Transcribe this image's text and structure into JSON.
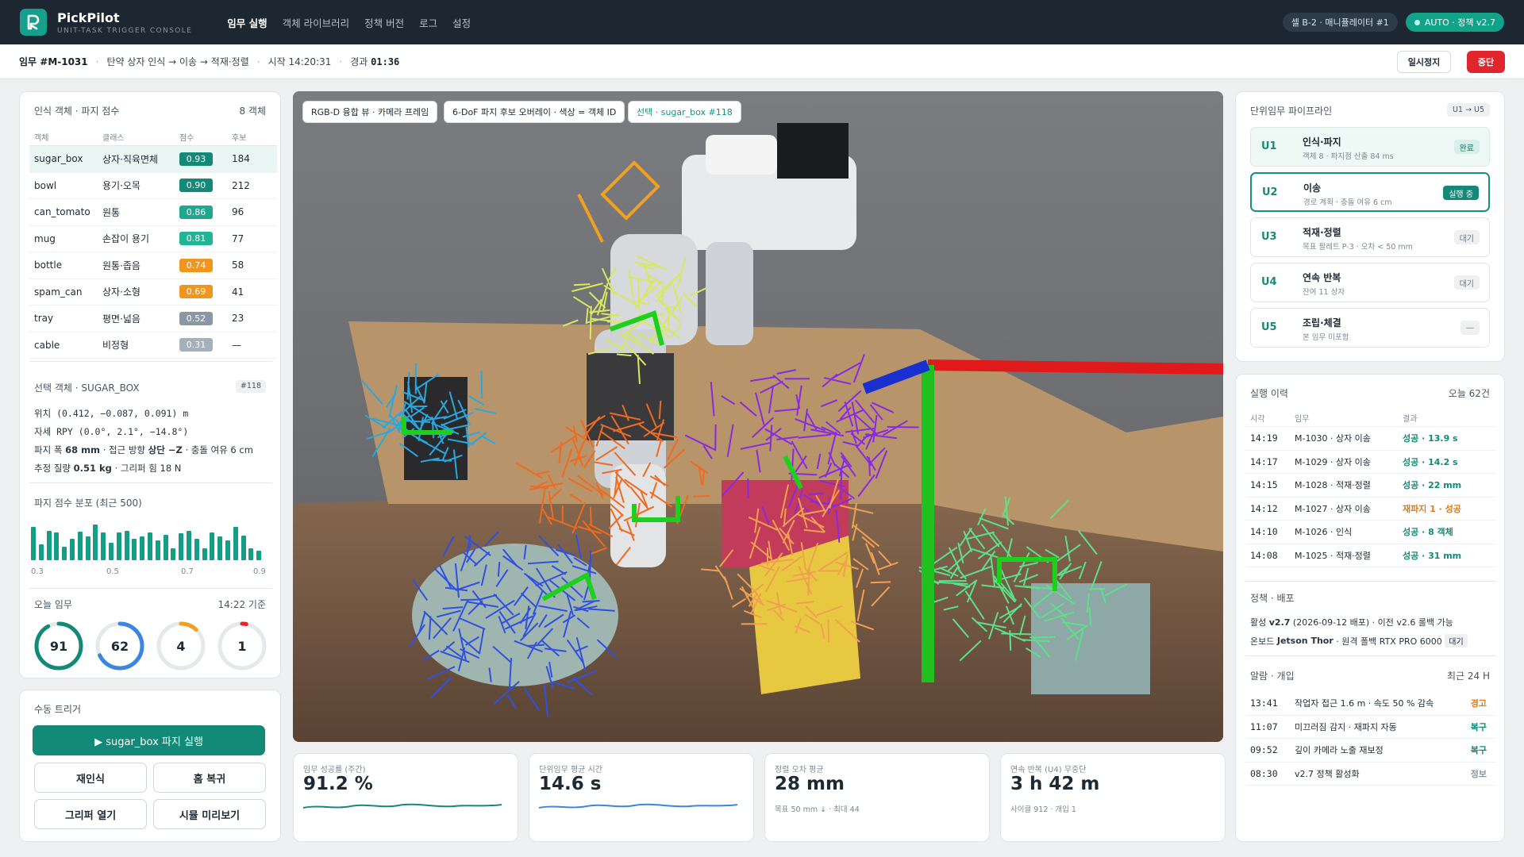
{
  "app": {
    "name": "PickPilot",
    "subtitle": "UNIT-TASK TRIGGER CONSOLE"
  },
  "nav": [
    "임무 실행",
    "객체 라이브러리",
    "정책 버전",
    "로그",
    "설정"
  ],
  "header_right": {
    "cell": "셀 B-2 · 매니퓰레이터 #1",
    "mode": "AUTO · 정책 v2.7"
  },
  "task": {
    "id": "임무 #M-1031",
    "desc": "탄약 상자 인식 → 이송 → 적재·정렬",
    "start": "시작 14:20:31",
    "elapsed_label": "경과",
    "elapsed": "01:36",
    "pause": "일시정지",
    "stop": "중단"
  },
  "objects": {
    "title": "인식 객체 · 파지 점수",
    "count": "8 객체",
    "headers": [
      "객체",
      "클래스",
      "점수",
      "후보"
    ],
    "rows": [
      {
        "name": "sugar_box",
        "cls": "상자·직육면체",
        "score": "0.93",
        "cand": "184",
        "color": "#138a77"
      },
      {
        "name": "bowl",
        "cls": "용기·오목",
        "score": "0.90",
        "cand": "212",
        "color": "#138a77"
      },
      {
        "name": "can_tomato",
        "cls": "원통",
        "score": "0.86",
        "cand": "96",
        "color": "#1fa88e"
      },
      {
        "name": "mug",
        "cls": "손잡이 용기",
        "score": "0.81",
        "cand": "77",
        "color": "#22b595"
      },
      {
        "name": "bottle",
        "cls": "원통·좁음",
        "score": "0.74",
        "cand": "58",
        "color": "#f0961f"
      },
      {
        "name": "spam_can",
        "cls": "상자·소형",
        "score": "0.69",
        "cand": "41",
        "color": "#f0961f"
      },
      {
        "name": "tray",
        "cls": "평면·넓음",
        "score": "0.52",
        "cand": "23",
        "color": "#8a98a6"
      },
      {
        "name": "cable",
        "cls": "비정형",
        "score": "0.31",
        "cand": "—",
        "color": "#a5b0ba"
      }
    ]
  },
  "selected": {
    "title": "선택 객체 · SUGAR_BOX",
    "badge": "#118",
    "pos": "위치 (0.412, −0.087, 0.091) m",
    "rpy": "자세 RPY (0.0°, 2.1°, −14.8°)",
    "grip_a": "파지 폭",
    "grip_b": "68 mm",
    "grip_c": "· 접근 방향",
    "grip_d": "상단 −Z",
    "grip_e": "· 충돌 여유 6 cm",
    "mass_a": "추정 질량",
    "mass_b": "0.51 kg",
    "mass_c": "· 그리퍼 힘 18 N"
  },
  "hist": {
    "title": "파지 점수 분포 (최근 500)",
    "ticks": [
      "0.3",
      "0.5",
      "0.7",
      "0.9"
    ],
    "bars": [
      0.85,
      0.4,
      0.75,
      0.7,
      0.35,
      0.55,
      0.72,
      0.6,
      0.9,
      0.7,
      0.45,
      0.7,
      0.75,
      0.55,
      0.6,
      0.7,
      0.5,
      0.65,
      0.3,
      0.68,
      0.75,
      0.55,
      0.3,
      0.7,
      0.6,
      0.5,
      0.85,
      0.62,
      0.3,
      0.25
    ]
  },
  "today": {
    "title": "오늘 임무",
    "asof": "14:22 기준",
    "rings": [
      {
        "value": "91",
        "color": "#138a77",
        "frac": 0.92
      },
      {
        "value": "62",
        "color": "#3a86e0",
        "frac": 0.68
      },
      {
        "value": "4",
        "color": "#f0a020",
        "frac": 0.12
      },
      {
        "value": "1",
        "color": "#e1252c",
        "frac": 0.03
      }
    ]
  },
  "manual": {
    "title": "수동 트리거",
    "main": "▶ sugar_box 파지 실행",
    "b1": "재인식",
    "b2": "홈 복귀",
    "b3": "그리퍼 열기",
    "b4": "시뮬 미리보기"
  },
  "viewport": {
    "tag1": "RGB-D 융합 뷰 · 카메라 프레임",
    "tag2": "6-DoF 파지 후보 오버레이 · 색상 = 객체 ID",
    "tag3": "선택 · sugar_box #118"
  },
  "kpis": [
    {
      "label": "임무 성공률 (주간)",
      "value": "91.2 %",
      "sub": "",
      "color": "#138a77"
    },
    {
      "label": "단위임무 평균 시간",
      "value": "14.6 s",
      "sub": "",
      "color": "#3a86e0"
    },
    {
      "label": "정렬 오차 평균",
      "value": "28 mm",
      "sub": "목표 50 mm ↓ · 최대 44",
      "color": ""
    },
    {
      "label": "연속 반복 (U4) 무중단",
      "value": "3 h 42 m",
      "sub": "사이클 912 · 개입 1",
      "color": ""
    }
  ],
  "pipeline": {
    "title": "단위임무 파이프라인",
    "range": "U1 → U5",
    "steps": [
      {
        "id": "U1",
        "title": "인식·파지",
        "sub": "객체 8 · 파지점 산출 84 ms",
        "badge": "완료",
        "state": "done"
      },
      {
        "id": "U2",
        "title": "이송",
        "sub": "경로 계획 · 충돌 여유 6 cm",
        "badge": "실행 중",
        "state": "active"
      },
      {
        "id": "U3",
        "title": "적재·정렬",
        "sub": "목표 팔레트 P-3 · 오차 < 50 mm",
        "badge": "대기",
        "state": "wait"
      },
      {
        "id": "U4",
        "title": "연속 반복",
        "sub": "잔여 11 상자",
        "badge": "대기",
        "state": "wait"
      },
      {
        "id": "U5",
        "title": "조립·체결",
        "sub": "본 임무 미포함",
        "badge": "—",
        "state": "wait"
      }
    ]
  },
  "history": {
    "title": "실행 이력",
    "count": "오늘 62건",
    "headers": [
      "시각",
      "임무",
      "결과"
    ],
    "rows": [
      {
        "t": "14:19",
        "m": "M-1030 · 상자 이송",
        "r": "성공 · 13.9 s",
        "c": "#138a77"
      },
      {
        "t": "14:17",
        "m": "M-1029 · 상자 이송",
        "r": "성공 · 14.2 s",
        "c": "#138a77"
      },
      {
        "t": "14:15",
        "m": "M-1028 · 적재·정렬",
        "r": "성공 · 22 mm",
        "c": "#138a77"
      },
      {
        "t": "14:12",
        "m": "M-1027 · 상자 이송",
        "r": "재파지 1 · 성공",
        "c": "#e07a12"
      },
      {
        "t": "14:10",
        "m": "M-1026 · 인식",
        "r": "성공 · 8 객체",
        "c": "#138a77"
      },
      {
        "t": "14:08",
        "m": "M-1025 · 적재·정렬",
        "r": "성공 · 31 mm",
        "c": "#138a77"
      }
    ]
  },
  "policy": {
    "title": "정책 · 배포",
    "line1a": "활성",
    "line1b": "v2.7",
    "line1c": "(2026-09-12 배포) · 이전 v2.6 롤백 가능",
    "line2a": "온보드",
    "line2b": "Jetson Thor",
    "line2c": "· 원격 폴백 RTX PRO 6000",
    "line2d": "대기"
  },
  "alerts": {
    "title": "알람 · 개입",
    "range": "최근 24 H",
    "rows": [
      {
        "t": "13:41",
        "m": "작업자 접근 1.6 m · 속도 50 % 감속",
        "r": "경고",
        "c": "#e07a12"
      },
      {
        "t": "11:07",
        "m": "미끄러짐 감지 · 재파지 자동",
        "r": "복구",
        "c": "#138a77"
      },
      {
        "t": "09:52",
        "m": "깊이 카메라 노출 재보정",
        "r": "복구",
        "c": "#138a77"
      },
      {
        "t": "08:30",
        "m": "v2.7 정책 활성화",
        "r": "정보",
        "c": "#8a96a0"
      }
    ]
  }
}
